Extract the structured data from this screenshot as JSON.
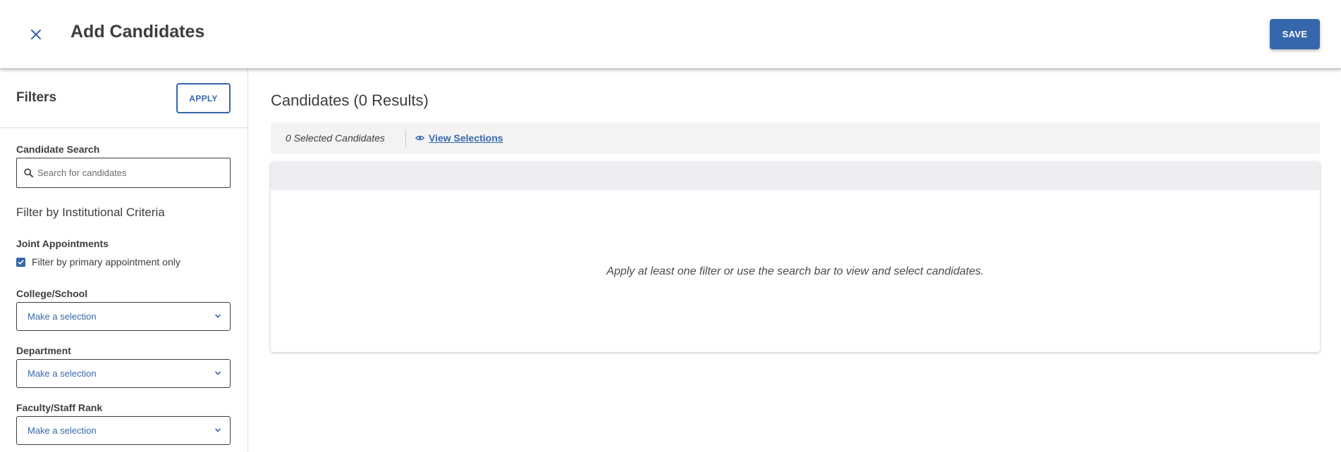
{
  "header": {
    "title": "Add Candidates",
    "save_label": "SAVE"
  },
  "filters": {
    "title": "Filters",
    "apply_label": "APPLY",
    "candidate_search": {
      "label": "Candidate Search",
      "placeholder": "Search for candidates",
      "value": ""
    },
    "section_heading": "Filter by Institutional Criteria",
    "joint_appointments": {
      "label": "Joint Appointments",
      "checkbox_label": "Filter by primary appointment only",
      "checked": true
    },
    "selects": [
      {
        "label": "College/School",
        "value": "Make a selection"
      },
      {
        "label": "Department",
        "value": "Make a selection"
      },
      {
        "label": "Faculty/Staff Rank",
        "value": "Make a selection"
      }
    ]
  },
  "main": {
    "results_title": "Candidates (0 Results)",
    "selected_count": "0 Selected Candidates",
    "view_selections_label": "View Selections",
    "empty_message": "Apply at least one filter or use the search bar to view and select candidates."
  },
  "colors": {
    "primary": "#3667ac",
    "text": "#3d3d3d",
    "bar_bg": "#f3f3f3",
    "panel_header_bg": "#eceef2"
  },
  "icons": {
    "close": "close-icon",
    "search": "search-icon",
    "checkbox": "check-icon",
    "dropdown": "chevron-down-icon",
    "view": "eye-icon"
  }
}
